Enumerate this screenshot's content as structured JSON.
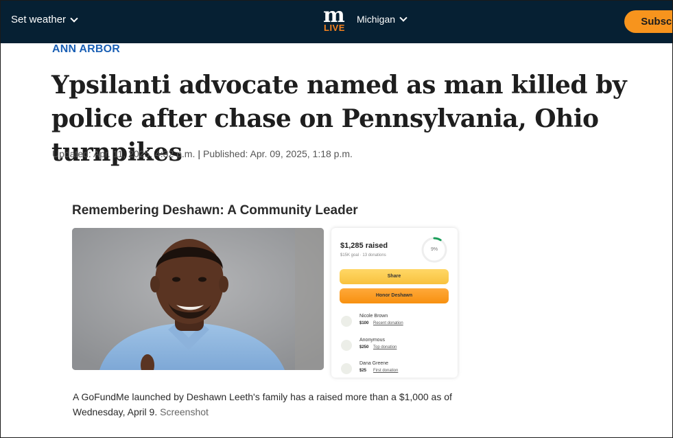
{
  "header": {
    "weather_label": "Set weather",
    "logo_letter": "m",
    "logo_word": "LIVE",
    "region_label": "Michigan",
    "subscribe_label": "Subscribe"
  },
  "article": {
    "section": "ANN ARBOR",
    "headline": "Ypsilanti advocate named as man killed by police after chase on Pennsylvania, Ohio turnpikes",
    "updated": "Updated: Apr. 11, 2025, 4:32 p.m.",
    "separator": "|",
    "published": "Published: Apr. 09, 2025, 1:18 p.m."
  },
  "screenshot": {
    "title": "Remembering Deshawn: A Community Leader",
    "raised": "$1,285 raised",
    "goal_text": "$15K goal · 13 donations",
    "progress_percent": 9,
    "progress_label": "9%",
    "share_label": "Share",
    "honor_label": "Honor Deshawn",
    "donors": [
      {
        "name": "Nicole Brown",
        "amount": "$100",
        "type": "Recent donation"
      },
      {
        "name": "Anonymous",
        "amount": "$250",
        "type": "Top donation"
      },
      {
        "name": "Dana Greene",
        "amount": "$25",
        "type": "First donation"
      }
    ]
  },
  "caption": {
    "text": "A GoFundMe launched by Deshawn Leeth's family has a raised more than a $1,000 as of Wednesday, April 9.",
    "credit": "Screenshot"
  },
  "colors": {
    "header_bg": "#062033",
    "accent_orange": "#f7941d",
    "section_blue": "#1a5fb4",
    "progress_green": "#1a9e5a"
  }
}
